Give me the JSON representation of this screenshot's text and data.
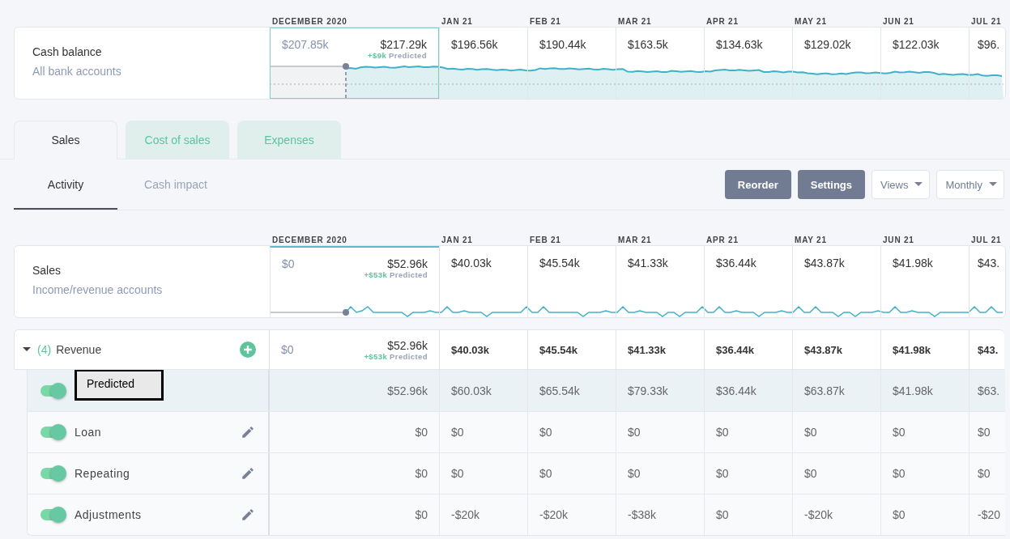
{
  "cash_months": [
    "DECEMBER 2020",
    "JAN 21",
    "FEB 21",
    "MAR 21",
    "APR 21",
    "MAY 21",
    "JUN 21",
    "JUL 21"
  ],
  "cash_balance": {
    "title": "Cash balance",
    "subtitle": "All bank accounts",
    "december": {
      "actual": "$207.85k",
      "total": "$217.29k",
      "delta": "+$9k",
      "delta_label": "Predicted"
    },
    "values": [
      "$196.56k",
      "$190.44k",
      "$163.5k",
      "$134.63k",
      "$129.02k",
      "$122.03k",
      "$96."
    ]
  },
  "tabs": [
    {
      "label": "Sales",
      "selected": true
    },
    {
      "label": "Cost of sales",
      "selected": false
    },
    {
      "label": "Expenses",
      "selected": false
    }
  ],
  "subtabs": [
    {
      "label": "Activity",
      "selected": true
    },
    {
      "label": "Cash impact",
      "selected": false
    }
  ],
  "actions": [
    {
      "label": "Reorder",
      "kind": "button"
    },
    {
      "label": "Settings",
      "kind": "button"
    },
    {
      "label": "Views",
      "kind": "dropdown"
    },
    {
      "label": "Monthly",
      "kind": "dropdown"
    }
  ],
  "sales_months": [
    "DECEMBER 2020",
    "JAN 21",
    "FEB 21",
    "MAR 21",
    "APR 21",
    "MAY 21",
    "JUN 21",
    "JUL 21"
  ],
  "sales_summary": {
    "title": "Sales",
    "subtitle": "Income/revenue accounts",
    "december": {
      "actual": "$0",
      "total": "$52.96k",
      "delta": "+$53k",
      "delta_label": "Predicted"
    },
    "values": [
      "$40.03k",
      "$45.54k",
      "$41.33k",
      "$36.44k",
      "$43.87k",
      "$41.98k",
      "$43."
    ]
  },
  "group": {
    "expanded": true,
    "count": "(4)",
    "name": "Revenue",
    "december": {
      "actual": "$0",
      "total": "$52.96k",
      "delta": "+$53k",
      "delta_label": "Predicted"
    },
    "values": [
      "$40.03k",
      "$45.54k",
      "$41.33k",
      "$36.44k",
      "$43.87k",
      "$41.98k",
      "$43."
    ]
  },
  "rows": [
    {
      "name": "Predicted",
      "kind": "predicted",
      "on": true,
      "selected": true,
      "december": "$52.96k",
      "values": [
        "$60.03k",
        "$65.54k",
        "$79.33k",
        "$36.44k",
        "$63.87k",
        "$41.98k",
        "$63."
      ]
    },
    {
      "name": "Loan",
      "kind": "manual",
      "on": true,
      "selected": false,
      "december": "$0",
      "values": [
        "$0",
        "$0",
        "$0",
        "$0",
        "$0",
        "$0",
        "$0"
      ]
    },
    {
      "name": "Repeating",
      "kind": "manual",
      "on": true,
      "selected": false,
      "december": "$0",
      "values": [
        "$0",
        "$0",
        "$0",
        "$0",
        "$0",
        "$0",
        "$0"
      ]
    },
    {
      "name": "Adjustments",
      "kind": "manual",
      "on": true,
      "selected": false,
      "december": "$0",
      "values": [
        "-$20k",
        "-$20k",
        "-$38k",
        "$0",
        "-$20k",
        "$0",
        "-$20"
      ]
    }
  ]
}
